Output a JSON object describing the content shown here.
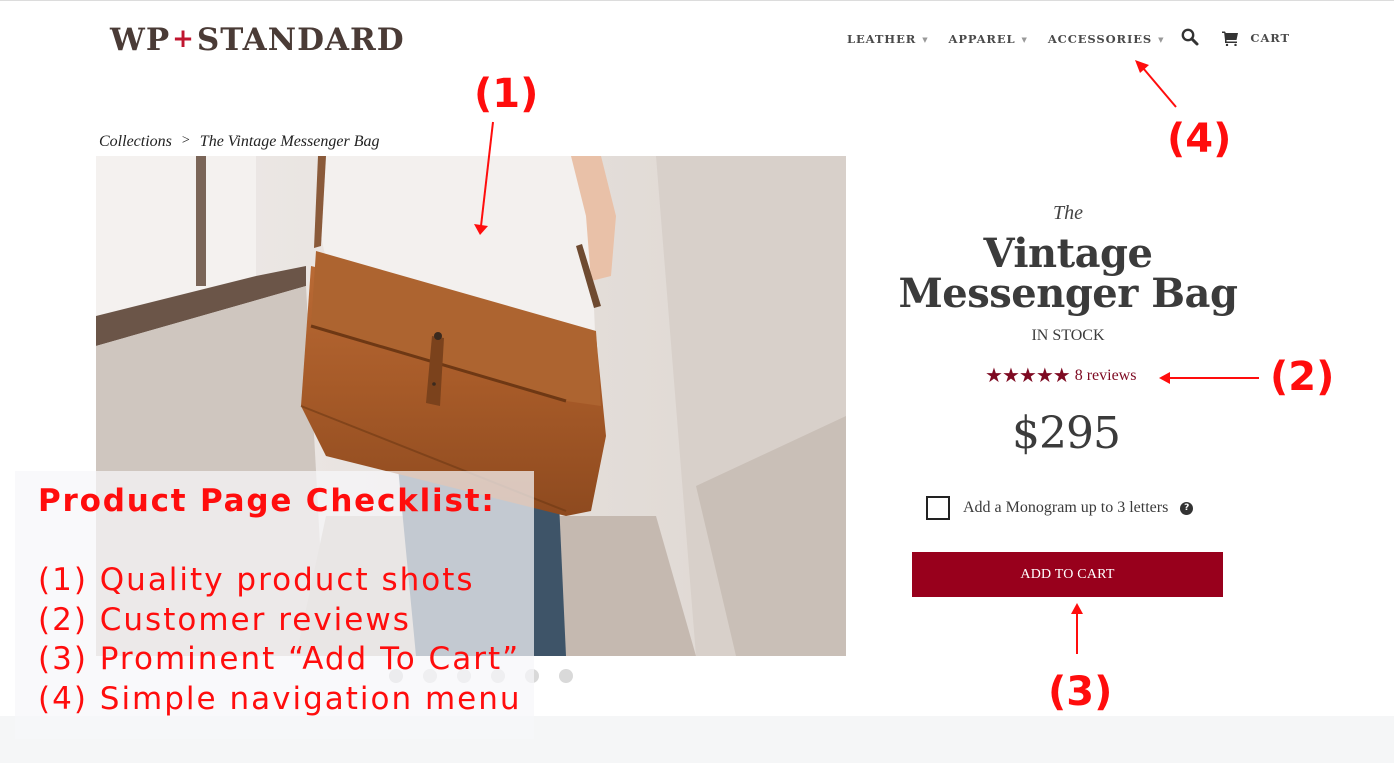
{
  "header": {
    "logo": {
      "left": "WP",
      "plus": "+",
      "right": "STANDARD"
    },
    "nav": [
      {
        "label": "LEATHER",
        "has_dropdown": true
      },
      {
        "label": "APPAREL",
        "has_dropdown": true
      },
      {
        "label": "ACCESSORIES",
        "has_dropdown": true
      }
    ],
    "search_icon": "search-icon",
    "cart_icon": "cart-icon",
    "cart_label": "CART"
  },
  "breadcrumb": {
    "parent": "Collections",
    "separator": ">",
    "current": "The Vintage Messenger Bag"
  },
  "gallery": {
    "image_alt": "Man wearing a brown leather vintage messenger bag",
    "dot_count": 6,
    "active_index": 0
  },
  "product": {
    "pre_title": "The",
    "title": "Vintage Messenger Bag",
    "stock_status": "IN STOCK",
    "rating": {
      "stars": 5,
      "max": 5,
      "reviews_label": "8 reviews"
    },
    "price": "$295",
    "monogram_option": {
      "label": "Add a Monogram up to 3 letters",
      "checked": false,
      "help_icon": "question-circle-icon"
    },
    "add_to_cart_label": "ADD TO CART"
  },
  "colors": {
    "brand_red": "#98001c",
    "star_color": "#7e0a22",
    "logo_brown": "#4a3b36",
    "logo_plus": "#c0152f",
    "annotation_red": "#ff0d0d"
  },
  "annotations": {
    "checklist_title": "Product Page Checklist:",
    "checklist_items": [
      "(1) Quality product shots",
      "(2) Customer reviews",
      "(3) Prominent “Add To Cart”",
      "(4) Simple navigation menu"
    ],
    "markers": [
      "(1)",
      "(2)",
      "(3)",
      "(4)"
    ]
  }
}
